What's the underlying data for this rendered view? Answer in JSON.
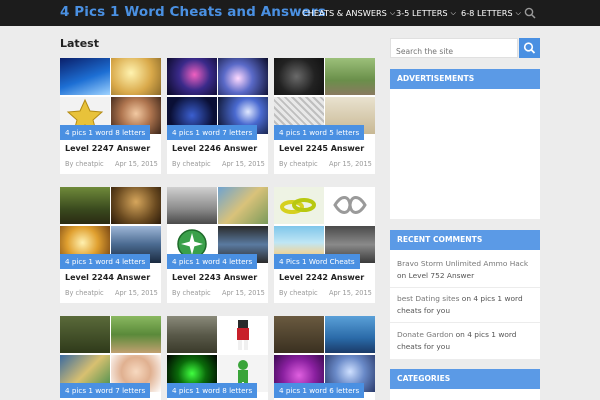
{
  "site": {
    "title": "4 Pics 1 Word Cheats and Answers"
  },
  "nav": {
    "items": [
      {
        "label": "CHEATS & ANSWERS"
      },
      {
        "label": "3-5 LETTERS"
      },
      {
        "label": "6-8 LETTERS"
      }
    ]
  },
  "main": {
    "section_title": "Latest",
    "posts": [
      {
        "tag": "4 pics 1 word 8 letters",
        "title": "Level 2247 Answer",
        "author": "By cheatpic",
        "date": "Apr 15, 2015"
      },
      {
        "tag": "4 pics 1 word 7 letters",
        "title": "Level 2246 Answer",
        "author": "By cheatpic",
        "date": "Apr 15, 2015"
      },
      {
        "tag": "4 pics 1 word 5 letters",
        "title": "Level 2245 Answer",
        "author": "By cheatpic",
        "date": "Apr 15, 2015"
      },
      {
        "tag": "4 pics 1 word 4 letters",
        "title": "Level 2244 Answer",
        "author": "By cheatpic",
        "date": "Apr 15, 2015"
      },
      {
        "tag": "4 pics 1 word 4 letters",
        "title": "Level 2243 Answer",
        "author": "By cheatpic",
        "date": "Apr 15, 2015"
      },
      {
        "tag": "4 Pics 1 Word Cheats",
        "title": "Level 2242 Answer",
        "author": "By cheatpic",
        "date": "Apr 15, 2015"
      },
      {
        "tag": "4 pics 1 word 7 letters",
        "title": "",
        "author": "",
        "date": ""
      },
      {
        "tag": "4 pics 1 word 8 letters",
        "title": "",
        "author": "",
        "date": ""
      },
      {
        "tag": "4 pics 1 word 6 letters",
        "title": "",
        "author": "",
        "date": ""
      }
    ]
  },
  "sidebar": {
    "search_placeholder": "Search the site",
    "advertisements_title": "ADVERTISEMENTS",
    "recent_comments_title": "RECENT COMMENTS",
    "recent_comments": [
      {
        "author": "Bravo Storm Unlimited Ammo Hack",
        "on": "on",
        "post": "Level 752 Answer"
      },
      {
        "author": "best Dating sites",
        "on": "on",
        "post": "4 pics 1 word cheats for you"
      },
      {
        "author": "Donate Gardon",
        "on": "on",
        "post": "4 pics 1 word cheats for you"
      }
    ],
    "categories_title": "CATEGORIES"
  },
  "colors": {
    "accent": "#4a90e2",
    "topbar": "#1c1c1c",
    "background": "#ececec",
    "widget_head": "#5b9ae6"
  }
}
